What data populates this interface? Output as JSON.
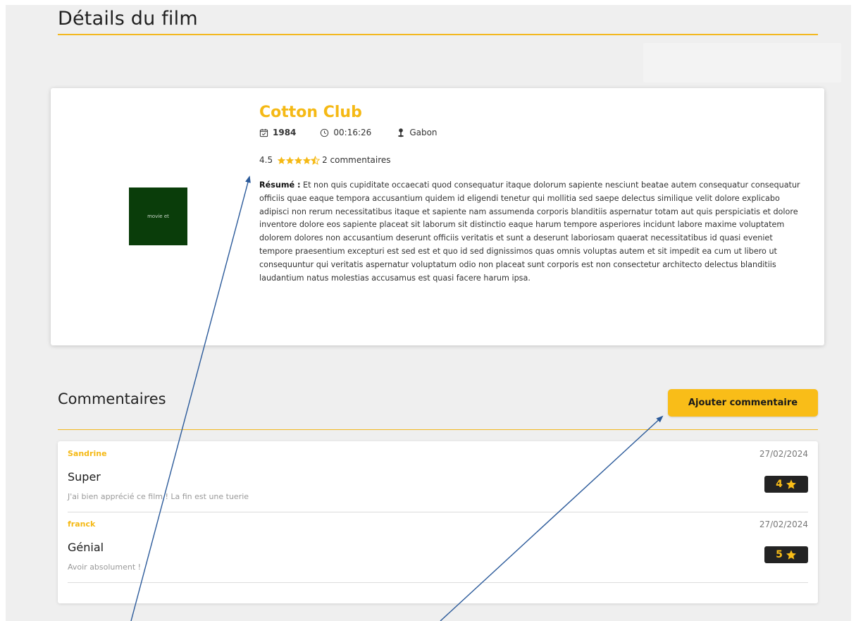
{
  "header": {
    "title": "Détails du film"
  },
  "movie": {
    "poster_alt": "movie et",
    "title": "Cotton Club",
    "year": "1984",
    "duration": "00:16:26",
    "country": "Gabon",
    "rating": "4.5",
    "rating_value": 4.5,
    "rating_max": 5,
    "comments_count_label": "2 commentaires",
    "summary_label": "Résumé :",
    "summary": "Et non quis cupiditate occaecati quod consequatur itaque dolorum sapiente nesciunt beatae autem consequatur consequatur officiis quae eaque tempora accusantium quidem id eligendi tenetur qui mollitia sed saepe delectus similique velit dolore explicabo adipisci non rerum necessitatibus itaque et sapiente nam assumenda corporis blanditiis aspernatur totam aut quis perspiciatis et dolore inventore dolore eos sapiente placeat sit laborum sit distinctio eaque harum tempore asperiores incidunt labore maxime voluptatem dolorem dolores non accusantium deserunt officiis veritatis et sunt a deserunt laboriosam quaerat necessitatibus id quasi eveniet tempore praesentium excepturi est sed est et quo id sed dignissimos quas omnis voluptas autem et sit impedit ea cum ut libero ut consequuntur qui veritatis aspernatur voluptatum odio non placeat sunt corporis est non consectetur architecto delectus blanditiis laudantium natus molestias accusamus est quasi facere harum ipsa."
  },
  "comments_section": {
    "title": "Commentaires",
    "add_button_label": "Ajouter commentaire",
    "items": [
      {
        "author": "Sandrine",
        "date": "27/02/2024",
        "title": "Super",
        "text": "J'ai bien apprécié ce film ! La fin est une tuerie",
        "score": "4"
      },
      {
        "author": "franck",
        "date": "27/02/2024",
        "title": "Génial",
        "text": "Avoir absolument !",
        "score": "5"
      }
    ]
  },
  "colors": {
    "accent": "#f5b915",
    "button": "#f9bd18",
    "badge_bg": "#232323",
    "poster_bg": "#0a3d0a",
    "arrow": "#2b5a9a"
  },
  "icons": [
    "calendar-icon",
    "clock-icon",
    "location-pin-icon",
    "star-icon",
    "star-half-icon"
  ]
}
